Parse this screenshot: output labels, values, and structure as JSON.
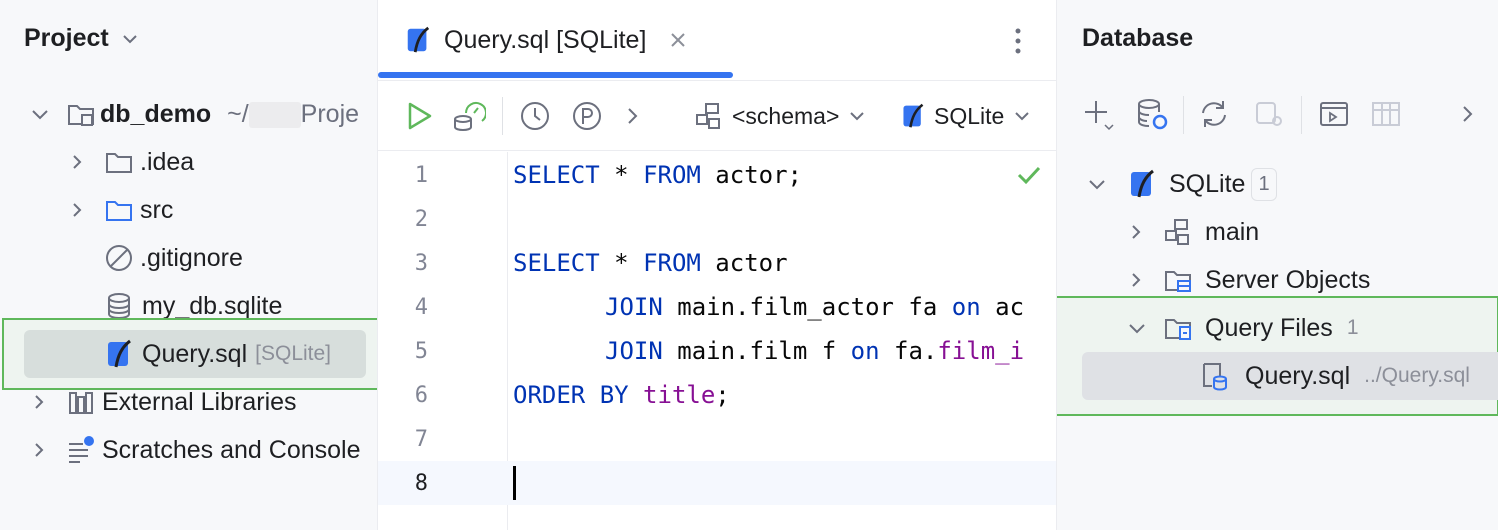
{
  "project": {
    "title": "Project",
    "root": {
      "name": "db_demo",
      "path_prefix": "~/",
      "path_suffix": "Proje"
    },
    "items": [
      {
        "label": ".idea"
      },
      {
        "label": "src"
      },
      {
        "label": ".gitignore"
      },
      {
        "label": "my_db.sqlite"
      },
      {
        "label": "Query.sql",
        "hint": "[SQLite]"
      }
    ],
    "external_libraries": "External Libraries",
    "scratches": "Scratches and Console"
  },
  "editor": {
    "tab_label": "Query.sql [SQLite]",
    "schema_dropdown": "<schema>",
    "datasource_dropdown": "SQLite",
    "lines": [
      {
        "n": "1"
      },
      {
        "n": "2"
      },
      {
        "n": "3"
      },
      {
        "n": "4"
      },
      {
        "n": "5"
      },
      {
        "n": "6"
      },
      {
        "n": "7"
      },
      {
        "n": "8"
      }
    ],
    "code": {
      "l1_kw1": "SELECT",
      "l1_mid": " * ",
      "l1_kw2": "FROM",
      "l1_rest": " actor;",
      "l3_kw1": "SELECT",
      "l3_mid": " * ",
      "l3_kw2": "FROM",
      "l3_rest": " actor",
      "l4_kw": "JOIN",
      "l4_a": " main.film_actor fa ",
      "l4_on": "on",
      "l4_b": " ac",
      "l5_kw": "JOIN",
      "l5_a": " main.film f ",
      "l5_on": "on",
      "l5_b": " fa.",
      "l5_fld": "film_i",
      "l6_kw": "ORDER BY",
      "l6_space": " ",
      "l6_fld": "title",
      "l6_end": ";"
    }
  },
  "database": {
    "title": "Database",
    "datasource": {
      "name": "SQLite",
      "count": "1"
    },
    "main": "main",
    "server_objects": "Server Objects",
    "query_files": {
      "label": "Query Files",
      "count": "1"
    },
    "query_file": {
      "label": "Query.sql",
      "path": "../Query.sql"
    }
  },
  "colors": {
    "accent": "#3574f0",
    "highlight_border": "#5fb85b",
    "keyword": "#0033b3",
    "field": "#871094",
    "run_green": "#5fb85b"
  }
}
